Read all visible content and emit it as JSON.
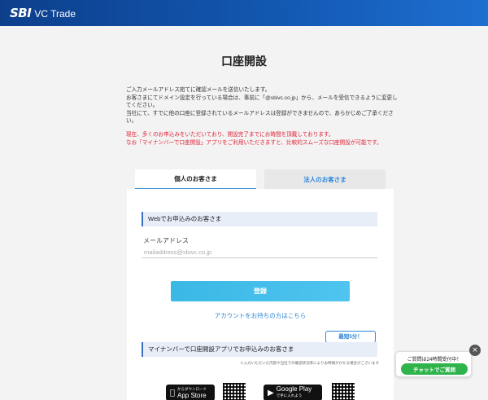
{
  "header": {
    "brand_sbi": "SBI",
    "brand_vc": "VC Trade",
    "bar_color": "#1257b0"
  },
  "page": {
    "title": "口座開設"
  },
  "notice": {
    "line1": "ご入力メールアドレス宛てに確認メールを送信いたします。",
    "line2": "お客さまにてドメイン設定を行っている場合は、事前に「@sbivc.co.jp」から、メールを受信できるように変更してください。",
    "line3": "当社にて、すでに他の口座に登録されているメールアドレスは登録ができませんので、あらかじめご了承ください。",
    "red1": "現在、多くのお申込みをいただいており、開設完了までにお時間を頂戴しております。",
    "red2": "なお「マイナンバーで口座開設」アプリをご利用いただきますと、比較的スムーズな口座開設が可能です。"
  },
  "tabs": {
    "individual": "個人のお客さま",
    "corporate": "法人のお客さま"
  },
  "web_form": {
    "section_title": "Webでお申込みのお客さま",
    "email_label": "メールアドレス",
    "email_placeholder": "mailaddress@sbivc.co.jp",
    "submit_label": "登録",
    "login_link": "アカウントをお持ちの方はこちら"
  },
  "app_section": {
    "title": "マイナンバーで口座開設アプリでお申込みのお客さま",
    "badge": "最短5分！",
    "note": "※入力いただいた内容や当社での確認状況等によりお時間がかかる場合がございます",
    "appstore_big": "App Store",
    "appstore_small": "からダウンロード",
    "gplay_big": "Google Play",
    "gplay_small": "で手に入れよう"
  },
  "chat": {
    "hours": "ご質問は24時間受付中！",
    "button": "チャットでご質問",
    "close_glyph": "×"
  }
}
